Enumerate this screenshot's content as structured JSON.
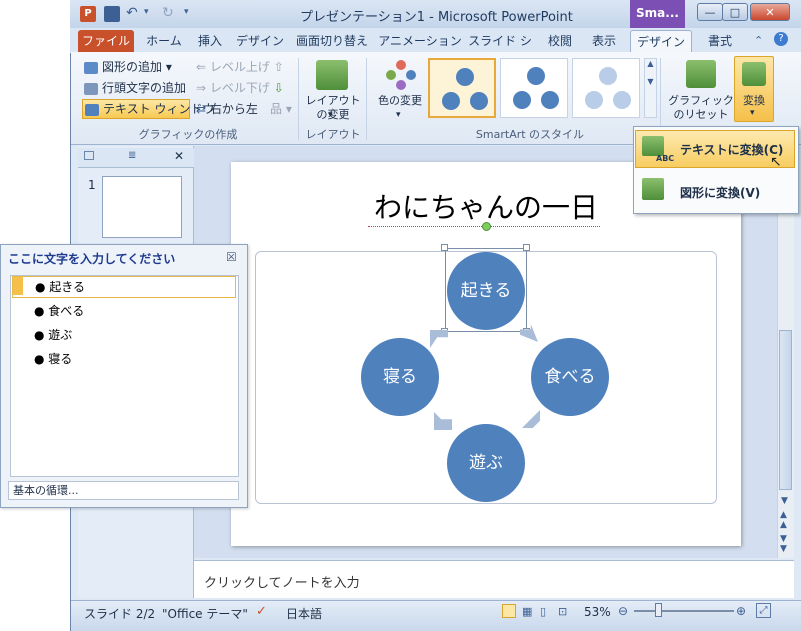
{
  "window": {
    "title": "プレゼンテーション1 - Microsoft PowerPoint",
    "context_tab": "Sma...",
    "buttons": {
      "minimize": "—",
      "maximize": "□",
      "close": "✕"
    }
  },
  "tabs": [
    "ファイル",
    "ホーム",
    "挿入",
    "デザイン",
    "画面切り替え",
    "アニメーション",
    "スライド ショー",
    "校閲",
    "表示",
    "デザイン",
    "書式"
  ],
  "ribbon": {
    "create_graphic": {
      "add_shape": "図形の追加",
      "add_bullet": "行頭文字の追加",
      "text_pane": "テキスト ウィンドウ",
      "promote": "レベル上げ",
      "demote": "レベル下げ",
      "right_to_left": "右から左",
      "label": "グラフィックの作成"
    },
    "layouts": {
      "button": "レイアウトの変更",
      "label": "レイアウト"
    },
    "styles": {
      "change_colors": "色の変更",
      "label": "SmartArt のスタイル"
    },
    "reset": {
      "button": "グラフィックのリセット"
    },
    "convert": {
      "button": "変換"
    }
  },
  "dropdown": {
    "items": [
      {
        "label": "テキストに変換(C)",
        "sub": "ABC"
      },
      {
        "label": "図形に変換(V)"
      }
    ]
  },
  "slides_pane": {
    "thumb_number": "1"
  },
  "slide": {
    "title": "わにちゃんの一日",
    "cycle": [
      "起きる",
      "食べる",
      "遊ぶ",
      "寝る"
    ]
  },
  "text_pane": {
    "title": "ここに文字を入力してください",
    "close": "☒",
    "items": [
      "起きる",
      "食べる",
      "遊ぶ",
      "寝る"
    ],
    "footer": "基本の循環..."
  },
  "notes": {
    "placeholder": "クリックしてノートを入力"
  },
  "status": {
    "slide": "スライド 2/2",
    "theme": "\"Office テーマ\"",
    "language": "日本語",
    "zoom": "53%"
  },
  "colors": {
    "accent": "#4f81bd",
    "file_tab": "#c8502a",
    "context": "#7b4fb3"
  }
}
